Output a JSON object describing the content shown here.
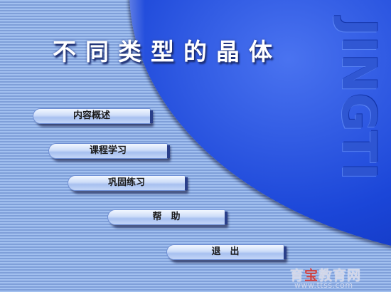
{
  "app": {
    "title": "不同类型的晶体",
    "watermark_text": "JINGTI"
  },
  "menu": {
    "items": [
      {
        "label": "内容概述"
      },
      {
        "label": "课程学习"
      },
      {
        "label": "巩固练习"
      },
      {
        "label": "帮　助"
      },
      {
        "label": "退　出"
      }
    ]
  },
  "footer": {
    "brand_part1": "育",
    "brand_part2": "宝",
    "brand_part3": "教育网",
    "url": "www.ttss.com"
  },
  "colors": {
    "background_stripe_light": "#a2c0ef",
    "background_stripe_dark": "#7f9fd9",
    "blob_blue": "#1b46d8",
    "title_text": "#ffffff",
    "button_face": "#cddcf8"
  }
}
